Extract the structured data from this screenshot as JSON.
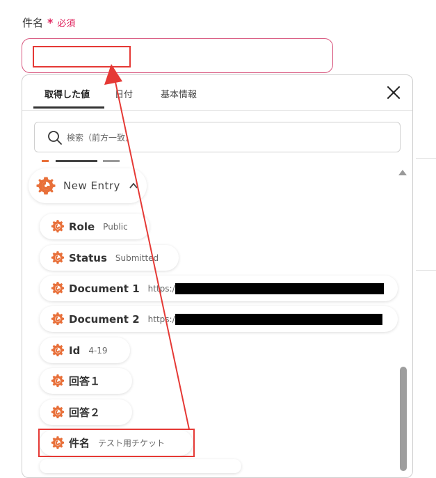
{
  "field": {
    "label": "件名",
    "required_star": "*",
    "required_text": "必須",
    "value": ""
  },
  "tabs": [
    {
      "label": "取得した値",
      "active": true
    },
    {
      "label": "日付",
      "active": false
    },
    {
      "label": "基本情報",
      "active": false
    }
  ],
  "search": {
    "placeholder": "検索（前方一致）"
  },
  "group": {
    "title": "New Entry",
    "icon": "gear-icon",
    "expanded": true
  },
  "items": [
    {
      "key": "Role",
      "value": "Public"
    },
    {
      "key": "Status",
      "value": "Submitted"
    },
    {
      "key": "Document 1",
      "value": "https:/",
      "redacted": true
    },
    {
      "key": "Document 2",
      "value": "https:/",
      "redacted": true
    },
    {
      "key": "Id",
      "value": "4-19"
    },
    {
      "key": "回答１",
      "value": ""
    },
    {
      "key": "回答２",
      "value": ""
    },
    {
      "key": "件名",
      "value": "テスト用チケット"
    }
  ],
  "colors": {
    "accent": "#e0245e",
    "icon": "#e8703a",
    "annotation": "#e53935"
  }
}
